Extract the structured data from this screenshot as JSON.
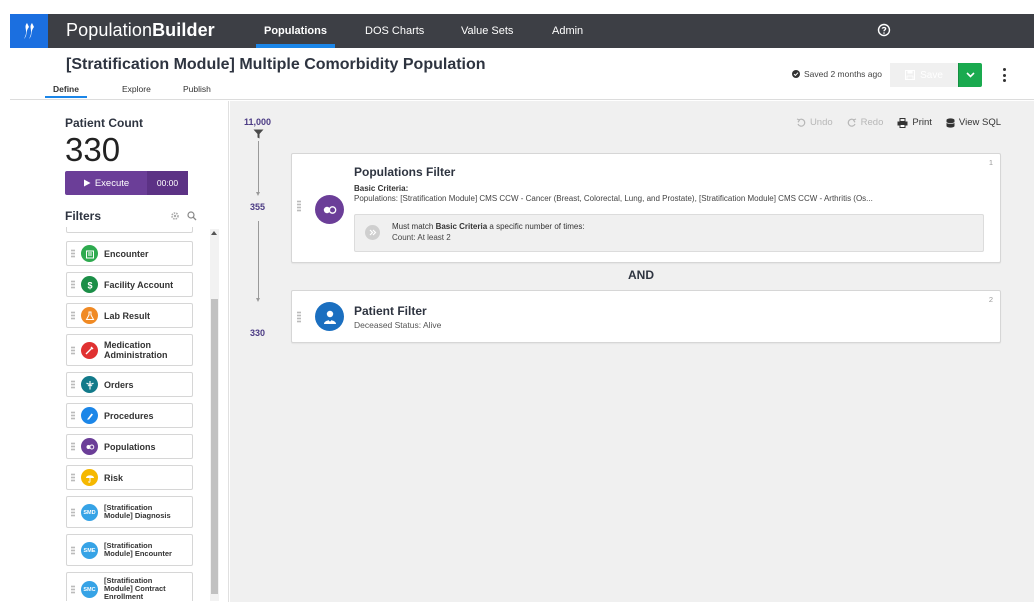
{
  "app": {
    "brand_light": "Population",
    "brand_bold": "Builder"
  },
  "nav": {
    "items": [
      {
        "label": "Populations",
        "active": true
      },
      {
        "label": "DOS Charts",
        "active": false
      },
      {
        "label": "Value Sets",
        "active": false
      },
      {
        "label": "Admin",
        "active": false
      }
    ]
  },
  "header": {
    "title": "[Stratification Module] Multiple Comorbidity Population",
    "tabs": [
      {
        "label": "Define",
        "active": true
      },
      {
        "label": "Explore",
        "active": false
      },
      {
        "label": "Publish",
        "active": false
      }
    ],
    "saved_status": "Saved 2 months ago",
    "save_label": "Save"
  },
  "left": {
    "patient_count_label": "Patient Count",
    "patient_count": "330",
    "execute_label": "Execute",
    "timer": "00:00",
    "filters_label": "Filters",
    "filters": [
      {
        "label": "Encounter",
        "icon": "encounter-icon",
        "color": "#2eaa4f"
      },
      {
        "label": "Facility Account",
        "icon": "dollar-icon",
        "color": "#1b8e47"
      },
      {
        "label": "Lab Result",
        "icon": "lab-flask-icon",
        "color": "#f08a24"
      },
      {
        "label_line1": "Medication",
        "label_line2": "Administration",
        "icon": "syringe-icon",
        "color": "#e03131"
      },
      {
        "label": "Orders",
        "icon": "caduceus-icon",
        "color": "#127a8a"
      },
      {
        "label": "Procedures",
        "icon": "scalpel-icon",
        "color": "#1b86e8"
      },
      {
        "label": "Populations",
        "icon": "populations-icon",
        "color": "#6b3e98"
      },
      {
        "label": "Risk",
        "icon": "umbrella-icon",
        "color": "#f5b800"
      },
      {
        "label_line1": "[Stratification",
        "label_line2": "Module] Diagnosis",
        "icon": "smd-icon",
        "badge": "SMD",
        "color": "#36a3e6"
      },
      {
        "label_line1": "[Stratification",
        "label_line2": "Module] Encounter",
        "icon": "sme-icon",
        "badge": "SME",
        "color": "#36a3e6"
      },
      {
        "label_line1": "[Stratification",
        "label_line2": "Module] Contract",
        "label_line3": "Enrollment",
        "icon": "smc-icon",
        "badge": "SMC",
        "color": "#36a3e6"
      }
    ]
  },
  "toolbar": {
    "undo": "Undo",
    "redo": "Redo",
    "print": "Print",
    "view_sql": "View SQL"
  },
  "flow": {
    "start_count": "11,000",
    "after_first": "355",
    "after_second": "330",
    "operator": "AND"
  },
  "cards": [
    {
      "index": "1",
      "title": "Populations Filter",
      "criteria_label": "Basic Criteria:",
      "criteria_value": "Populations: [Stratification Module] CMS CCW - Cancer (Breast, Colorectal, Lung, and Prostate), [Stratification Module] CMS CCW - Arthritis (Os...",
      "note_prefix": "Must match ",
      "note_bold": "Basic Criteria",
      "note_suffix": " a specific number of times:",
      "note_count": "Count: At least 2"
    },
    {
      "index": "2",
      "title": "Patient Filter",
      "subtitle": "Deceased Status: Alive"
    }
  ],
  "colors": {
    "nav_bg": "#3d3f45",
    "accent_blue": "#1b86e8",
    "purple": "#6b3e98",
    "save_green": "#1aaa4f"
  }
}
